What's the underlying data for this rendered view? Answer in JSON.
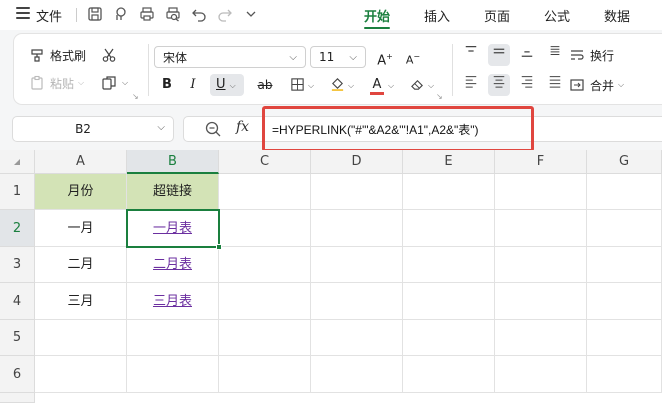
{
  "menu": {
    "file_label": "文件",
    "tabs": [
      {
        "label": "开始",
        "active": true
      },
      {
        "label": "插入",
        "active": false
      },
      {
        "label": "页面",
        "active": false
      },
      {
        "label": "公式",
        "active": false
      },
      {
        "label": "数据",
        "active": false
      }
    ],
    "quick_access_icons": [
      "save-icon",
      "export-icon",
      "print-icon",
      "print-preview-icon",
      "undo-icon",
      "redo-icon",
      "more-chevron-icon"
    ]
  },
  "ribbon": {
    "format_painter_label": "格式刷",
    "paste_label": "粘贴",
    "font_name": "宋体",
    "font_size": "11",
    "bold": "B",
    "italic": "I",
    "underline": "U",
    "strikethrough": "ab",
    "font_grow": "A",
    "font_shrink": "A",
    "font_color_letter": "A",
    "wrap_label": "换行",
    "merge_label": "合并",
    "font_color": "#e0463f",
    "fill_color": "#f4c542"
  },
  "formula_bar": {
    "cell_ref": "B2",
    "fx_label": "fx",
    "formula": "=HYPERLINK(\"#'\"&A2&\"'!A1\",A2&\"表\")",
    "highlight_color": "#e0463f"
  },
  "sheet": {
    "columns": [
      "A",
      "B",
      "C",
      "D",
      "E",
      "F",
      "G"
    ],
    "rows": [
      "1",
      "2",
      "3",
      "4",
      "5",
      "6"
    ],
    "active_column": "B",
    "active_row": "2",
    "header_fill": "#d3e3b6",
    "cells": {
      "A1": "月份",
      "B1": "超链接",
      "A2": "一月",
      "B2": "一月表",
      "A3": "二月",
      "B3": "二月表",
      "A4": "三月",
      "B4": "三月表"
    }
  }
}
